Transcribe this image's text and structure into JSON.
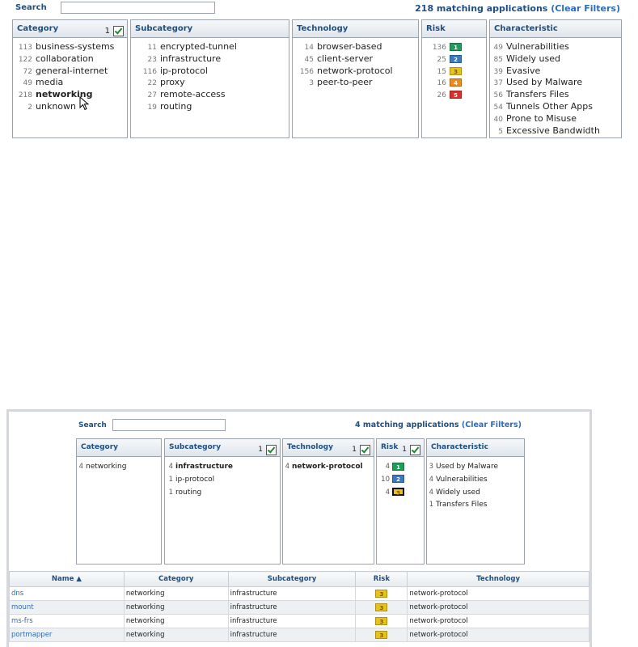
{
  "panel1": {
    "search_label": "Search",
    "search_value": "",
    "match_text": "218 matching applications",
    "clear_filters": "(Clear Filters)",
    "category": {
      "title": "Category",
      "selected_count": "1",
      "items": [
        {
          "count": "113",
          "label": "business-systems"
        },
        {
          "count": "122",
          "label": "collaboration"
        },
        {
          "count": "72",
          "label": "general-internet"
        },
        {
          "count": "49",
          "label": "media"
        },
        {
          "count": "218",
          "label": "networking"
        },
        {
          "count": "2",
          "label": "unknown"
        }
      ]
    },
    "subcategory": {
      "title": "Subcategory",
      "items": [
        {
          "count": "11",
          "label": "encrypted-tunnel"
        },
        {
          "count": "23",
          "label": "infrastructure"
        },
        {
          "count": "116",
          "label": "ip-protocol"
        },
        {
          "count": "22",
          "label": "proxy"
        },
        {
          "count": "27",
          "label": "remote-access"
        },
        {
          "count": "19",
          "label": "routing"
        }
      ]
    },
    "technology": {
      "title": "Technology",
      "items": [
        {
          "count": "14",
          "label": "browser-based"
        },
        {
          "count": "45",
          "label": "client-server"
        },
        {
          "count": "156",
          "label": "network-protocol"
        },
        {
          "count": "3",
          "label": "peer-to-peer"
        }
      ]
    },
    "risk": {
      "title": "Risk",
      "items": [
        {
          "count": "136",
          "level": "1",
          "color": "#1e9e5a"
        },
        {
          "count": "25",
          "level": "2",
          "color": "#3a78c3"
        },
        {
          "count": "15",
          "level": "3",
          "color": "#e8c21a"
        },
        {
          "count": "16",
          "level": "4",
          "color": "#f08a1c"
        },
        {
          "count": "26",
          "level": "5",
          "color": "#d9302c"
        }
      ]
    },
    "characteristic": {
      "title": "Characteristic",
      "items": [
        {
          "count": "49",
          "label": "Vulnerabilities"
        },
        {
          "count": "85",
          "label": "Widely used"
        },
        {
          "count": "39",
          "label": "Evasive"
        },
        {
          "count": "37",
          "label": "Used by Malware"
        },
        {
          "count": "56",
          "label": "Transfers Files"
        },
        {
          "count": "54",
          "label": "Tunnels Other Apps"
        },
        {
          "count": "40",
          "label": "Prone to Misuse"
        },
        {
          "count": "5",
          "label": "Excessive Bandwidth"
        }
      ]
    }
  },
  "panel2": {
    "search_label": "Search",
    "search_value": "",
    "match_text": "4 matching applications",
    "clear_filters": "(Clear Filters)",
    "category": {
      "title": "Category",
      "items": [
        {
          "count": "4",
          "label": "networking"
        }
      ]
    },
    "subcategory": {
      "title": "Subcategory",
      "selected_count": "1",
      "items": [
        {
          "count": "4",
          "label": "infrastructure"
        },
        {
          "count": "1",
          "label": "ip-protocol"
        },
        {
          "count": "1",
          "label": "routing"
        }
      ]
    },
    "technology": {
      "title": "Technology",
      "selected_count": "1",
      "items": [
        {
          "count": "4",
          "label": "network-protocol"
        }
      ]
    },
    "risk": {
      "title": "Risk",
      "selected_count": "1",
      "items": [
        {
          "count": "4",
          "level": "1",
          "color": "#1e9e5a"
        },
        {
          "count": "10",
          "level": "2",
          "color": "#3a78c3"
        },
        {
          "count": "4",
          "level": "3",
          "color": "#e8c21a"
        }
      ]
    },
    "characteristic": {
      "title": "Characteristic",
      "items": [
        {
          "count": "3",
          "label": "Used by Malware"
        },
        {
          "count": "4",
          "label": "Vulnerabilities"
        },
        {
          "count": "4",
          "label": "Widely used"
        },
        {
          "count": "1",
          "label": "Transfers Files"
        }
      ]
    },
    "table": {
      "columns": [
        "Name ▲",
        "Category",
        "Subcategory",
        "Risk",
        "Technology"
      ],
      "rows": [
        {
          "name": "dns",
          "category": "networking",
          "subcategory": "infrastructure",
          "risk": "3",
          "technology": "network-protocol"
        },
        {
          "name": "mount",
          "category": "networking",
          "subcategory": "infrastructure",
          "risk": "3",
          "technology": "network-protocol"
        },
        {
          "name": "ms-frs",
          "category": "networking",
          "subcategory": "infrastructure",
          "risk": "3",
          "technology": "network-protocol"
        },
        {
          "name": "portmapper",
          "category": "networking",
          "subcategory": "infrastructure",
          "risk": "3",
          "technology": "network-protocol"
        }
      ]
    }
  }
}
